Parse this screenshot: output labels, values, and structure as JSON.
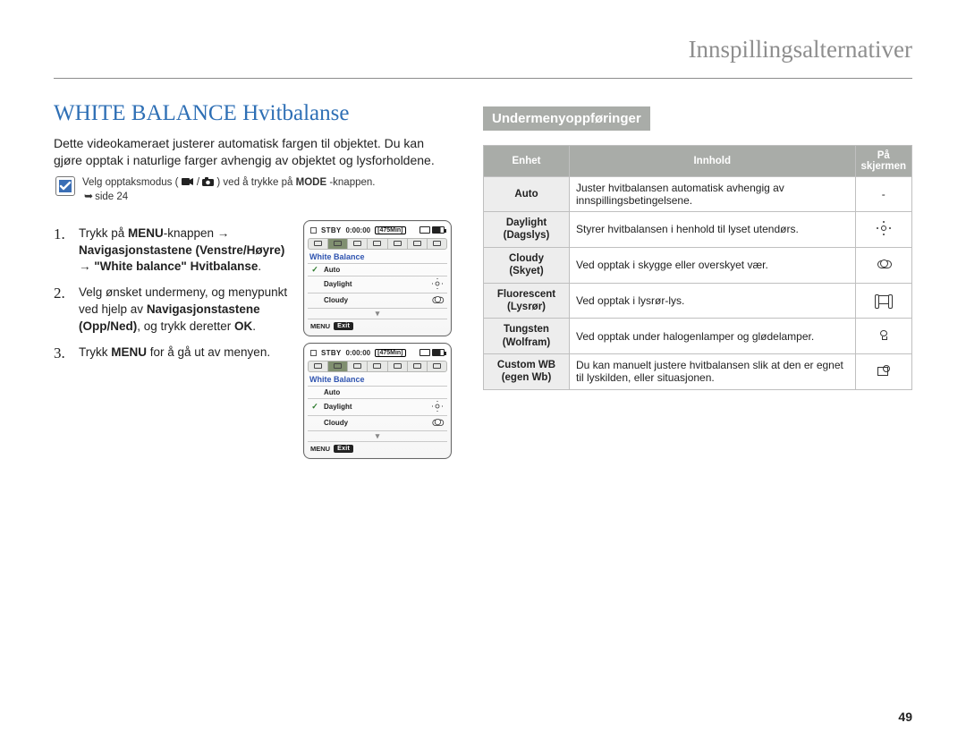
{
  "header": {
    "breadcrumb": "Innspillingsalternativer"
  },
  "page": {
    "title": "WHITE BALANCE Hvitbalanse",
    "intro": "Dette videokameraet justerer automatisk fargen til objektet. Du kan gjøre opptak i naturlige farger avhengig av objektet og lysforholdene.",
    "mode_note_pre": "Velg opptaksmodus (",
    "mode_note_post": ") ved å trykke på ",
    "mode_btn": "MODE",
    "mode_note_end": "-knappen.",
    "mode_ref": "side 24",
    "number": "49"
  },
  "steps": [
    {
      "n": "1.",
      "p1": "Trykk på ",
      "b1": "MENU",
      "p2": "-knappen → ",
      "b2": "Navigasjonstastene (Venstre/Høyre)",
      "p3": " → ",
      "b3": "\"White balance\" Hvitbalanse",
      "p4": "."
    },
    {
      "n": "2.",
      "p1": "Velg ønsket undermeny, og menypunkt ved hjelp av ",
      "b1": "Navigasjonstastene (Opp/Ned)",
      "p2": ", og trykk deretter ",
      "b2": "OK",
      "p3": "."
    },
    {
      "n": "3.",
      "p1": "Trykk ",
      "b1": "MENU",
      "p2": " for å gå ut av menyen."
    }
  ],
  "lcd": {
    "stby": "STBY",
    "time": "0:00:00",
    "dur": "[475Min]",
    "section": "White Balance",
    "menu": "MENU",
    "exit": "Exit",
    "screens": [
      {
        "items": [
          {
            "chk": true,
            "label": "Auto",
            "icon": ""
          },
          {
            "chk": false,
            "label": "Daylight",
            "icon": "sun"
          },
          {
            "chk": false,
            "label": "Cloudy",
            "icon": "cloud"
          }
        ]
      },
      {
        "items": [
          {
            "chk": false,
            "label": "Auto",
            "icon": ""
          },
          {
            "chk": true,
            "label": "Daylight",
            "icon": "sun"
          },
          {
            "chk": false,
            "label": "Cloudy",
            "icon": "cloud"
          }
        ]
      }
    ]
  },
  "right": {
    "sub_heading": "Undermenyoppføringer",
    "thead": {
      "unit": "Enhet",
      "content": "Innhold",
      "screen": "På skjermen"
    },
    "rows": [
      {
        "unit": "Auto",
        "secondary": "",
        "content": "Juster hvitbalansen automatisk avhengig av innspillingsbetingelsene.",
        "icon": "-"
      },
      {
        "unit": "Daylight",
        "secondary": "(Dagslys)",
        "content": "Styrer hvitbalansen i henhold til lyset utendørs.",
        "icon": "sun"
      },
      {
        "unit": "Cloudy",
        "secondary": "(Skyet)",
        "content": "Ved opptak i skygge eller overskyet vær.",
        "icon": "cloud"
      },
      {
        "unit": "Fluorescent",
        "secondary": "(Lysrør)",
        "content": "Ved opptak i lysrør-lys.",
        "icon": "fluo"
      },
      {
        "unit": "Tungsten",
        "secondary": "(Wolfram)",
        "content": "Ved opptak under halogenlamper og glødelamper.",
        "icon": "bulb"
      },
      {
        "unit": "Custom WB",
        "secondary": "(egen Wb)",
        "content": "Du kan manuelt justere hvitbalansen slik at den er egnet til lyskilden, eller situasjonen.",
        "icon": "wb"
      }
    ]
  }
}
